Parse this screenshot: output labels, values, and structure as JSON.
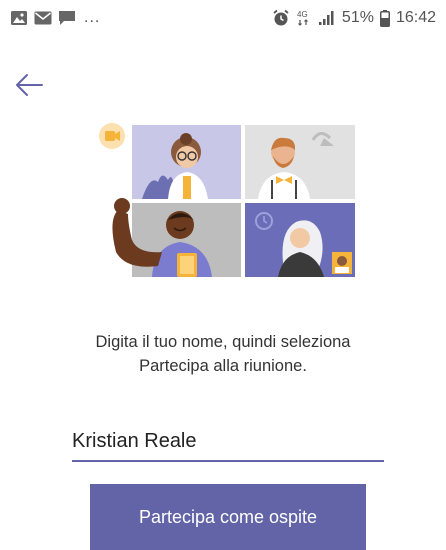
{
  "status_bar": {
    "left_icons": [
      "image-icon",
      "mail-icon",
      "chat-icon"
    ],
    "dots": "...",
    "right_icons": [
      "alarm-icon",
      "data-4g-icon",
      "signal-icon",
      "battery-icon"
    ],
    "network": "4G",
    "battery_percent": "51%",
    "time": "16:42"
  },
  "back_icon": "back-arrow-icon",
  "instruction": {
    "line1": "Digita il tuo nome, quindi seleziona",
    "line2": "Partecipa alla riunione."
  },
  "name_field": {
    "value": "Kristian Reale"
  },
  "join_button": {
    "label": "Partecipa come ospite"
  },
  "colors": {
    "accent": "#6264a7",
    "text": "#333333",
    "status": "#555555"
  }
}
